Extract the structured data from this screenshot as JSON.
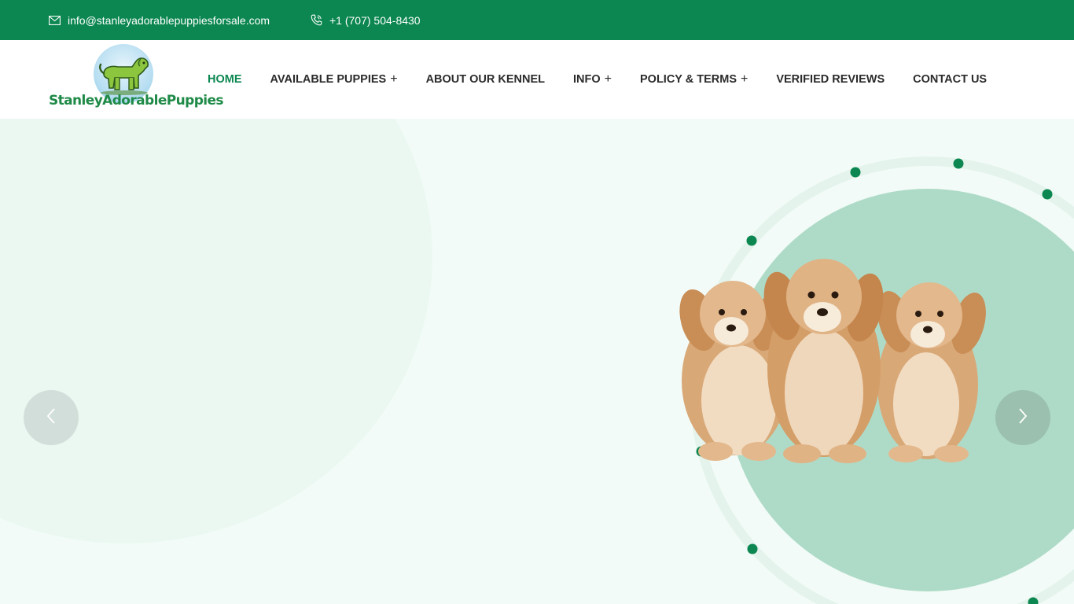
{
  "topbar": {
    "email": {
      "icon": "envelope-icon",
      "text": "info@stanleyadorablepuppiesforsale.com"
    },
    "phone": {
      "icon": "phone-icon",
      "text": "+1 (707) 504-8430"
    }
  },
  "logo": {
    "text": "StanleyAdorablePuppies"
  },
  "nav": {
    "items": [
      {
        "label": "HOME",
        "active": true
      },
      {
        "label": "AVAILABLE PUPPIES",
        "has_submenu": true
      },
      {
        "label": "ABOUT OUR KENNEL"
      },
      {
        "label": "INFO",
        "has_submenu": true
      },
      {
        "label": "POLICY & TERMS",
        "has_submenu": true
      },
      {
        "label": "VERIFIED REVIEWS"
      },
      {
        "label": "CONTACT US"
      }
    ],
    "submenu_indicator": "+"
  },
  "hero": {
    "slider_prev_icon": "chevron-left-icon",
    "slider_next_icon": "chevron-right-icon"
  },
  "colors": {
    "brand_green": "#0c8751",
    "hero_bg": "#f2fbf7",
    "circle_fill": "#aedbc8",
    "logo_text": "#1f8a47"
  }
}
